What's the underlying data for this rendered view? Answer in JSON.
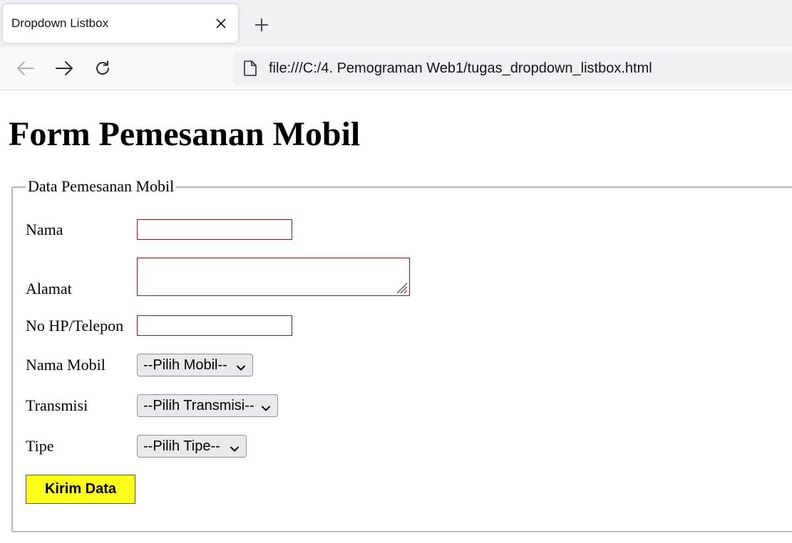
{
  "browser": {
    "tab_title": "Dropdown Listbox",
    "url": "file:///C:/4. Pemograman Web1/tugas_dropdown_listbox.html",
    "icons": [
      "close-icon",
      "plus-icon",
      "back-arrow-icon",
      "forward-arrow-icon",
      "reload-icon",
      "document-icon"
    ]
  },
  "page": {
    "title": "Form Pemesanan Mobil",
    "fieldset_legend": "Data Pemesanan Mobil"
  },
  "form": {
    "nama_label": "Nama",
    "nama_value": "",
    "alamat_label": "Alamat",
    "alamat_value": "",
    "hp_label": "No HP/Telepon",
    "hp_value": "",
    "mobil_label": "Nama Mobil",
    "mobil_selected": "--Pilih Mobil--",
    "transmisi_label": "Transmisi",
    "transmisi_selected": "--Pilih Transmisi--",
    "tipe_label": "Tipe",
    "tipe_selected": "--Pilih Tipe--",
    "submit_label": "Kirim Data"
  },
  "colors": {
    "submit_button_bg": "#ffff1a",
    "input_border": "#7a1f1f"
  }
}
